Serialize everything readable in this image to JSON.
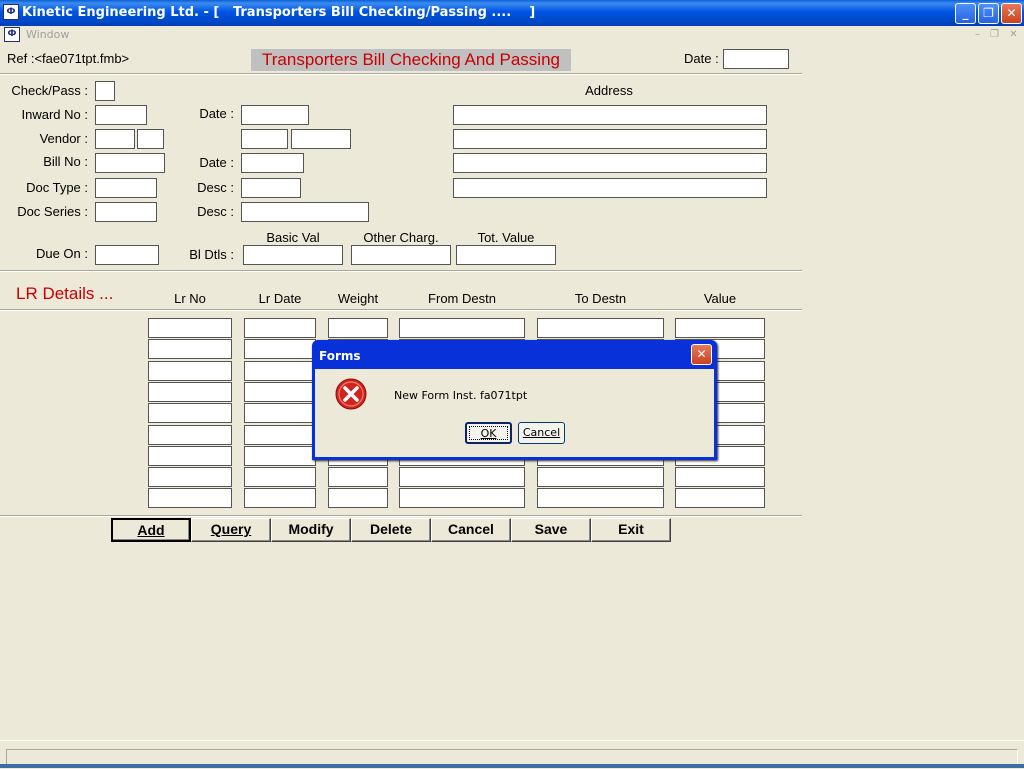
{
  "window": {
    "title": "Kinetic Engineering Ltd. - [   Transporters Bill Checking/Passing ....    ]",
    "menu_window": "Window",
    "btn_minimize": "_",
    "btn_restore": "❐",
    "btn_close": "✕",
    "mdi_min": "–",
    "mdi_restore": "❐",
    "mdi_close": "✕"
  },
  "header": {
    "ref": "Ref :<fae071tpt.fmb>",
    "form_title": "Transporters Bill Checking And Passing",
    "date_label": "Date :"
  },
  "form": {
    "check_pass": "Check/Pass :",
    "inward_no": "Inward No :",
    "vendor": "Vendor :",
    "bill_no": "Bill No :",
    "doc_type": "Doc Type :",
    "doc_series": "Doc Series :",
    "due_on": "Due On :",
    "date1": "Date :",
    "date2": "Date :",
    "desc1": "Desc :",
    "desc2": "Desc :",
    "bl_dtls": "Bl Dtls :",
    "address": "Address",
    "basic_val": "Basic Val",
    "other_charg": "Other Charg.",
    "tot_value": "Tot. Value"
  },
  "lr": {
    "section_title": "LR Details   ...",
    "columns": [
      "Lr No",
      "Lr Date",
      "Weight",
      "From Destn",
      "To Destn",
      "Value"
    ]
  },
  "buttons": {
    "add": "Add",
    "query": "Query",
    "modify": "Modify",
    "delete": "Delete",
    "cancel": "Cancel",
    "save": "Save",
    "exit": "Exit"
  },
  "dialog": {
    "title": "Forms",
    "message": "New Form Inst. fa071tpt",
    "ok": "OK",
    "cancel": "Cancel"
  },
  "colors": {
    "title_accent": "#c80000",
    "dialog_frame": "#0831d9",
    "error_red": "#d2231e"
  }
}
